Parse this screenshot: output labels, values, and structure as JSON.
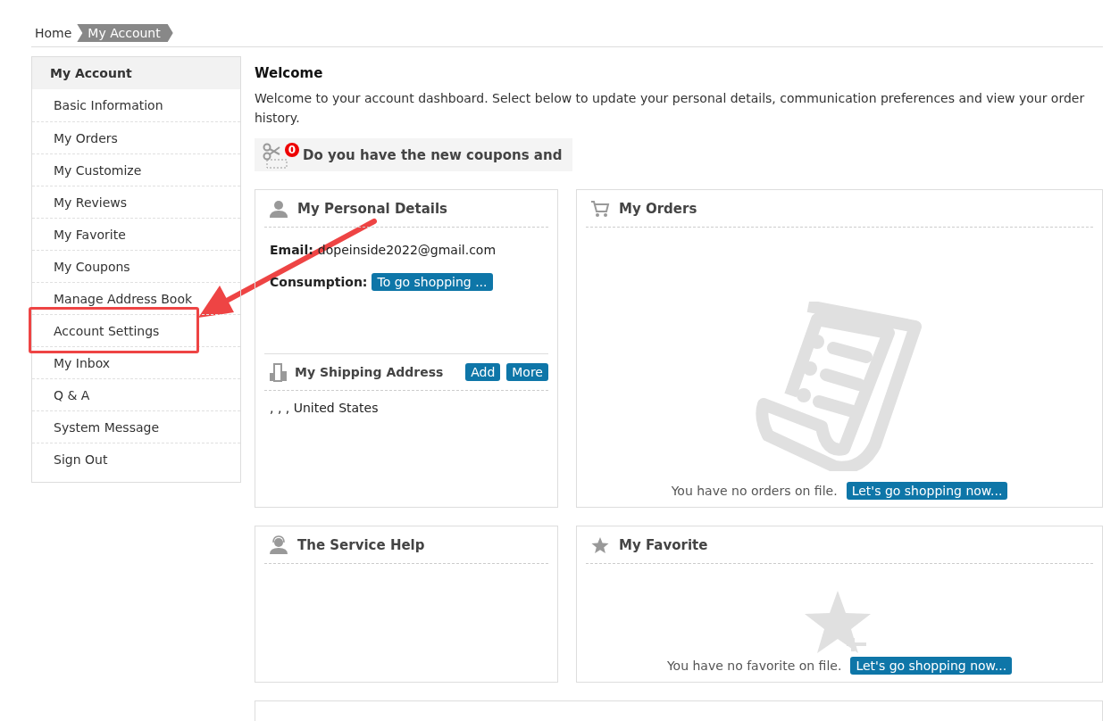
{
  "breadcrumb": [
    {
      "label": "Home",
      "selected": false
    },
    {
      "label": "My Account",
      "selected": true
    }
  ],
  "sidebar": {
    "title": "My Account",
    "items": [
      {
        "label": "Basic Information",
        "highlighted": false
      },
      {
        "label": "My Orders",
        "highlighted": false
      },
      {
        "label": "My Customize",
        "highlighted": false
      },
      {
        "label": "My Reviews",
        "highlighted": false
      },
      {
        "label": "My Favorite",
        "highlighted": false
      },
      {
        "label": "My Coupons",
        "highlighted": false
      },
      {
        "label": "Manage Address Book",
        "highlighted": false
      },
      {
        "label": "Account Settings",
        "highlighted": true
      },
      {
        "label": "My Inbox",
        "highlighted": false
      },
      {
        "label": "Q & A",
        "highlighted": false
      },
      {
        "label": "System Message",
        "highlighted": false
      },
      {
        "label": "Sign Out",
        "highlighted": false
      }
    ]
  },
  "welcome": {
    "title": "Welcome",
    "text": "Welcome to your account dashboard. Select below to update your personal details, communication preferences and view your order history."
  },
  "coupon": {
    "count": "0",
    "text": "Do you have the new coupons and"
  },
  "personal_details": {
    "title": "My Personal Details",
    "email_label": "Email:",
    "email": "dopeinside2022@gmail.com",
    "consumption_label": "Consumption:",
    "consumption_button": "To go shopping ..."
  },
  "shipping_address": {
    "title": "My Shipping Address",
    "buttons": [
      "Add",
      "More"
    ],
    "address": ", , , United States"
  },
  "orders": {
    "title": "My Orders",
    "empty_text": "You have no orders on file.",
    "button": "Let's go shopping now..."
  },
  "service_help": {
    "title": "The Service Help"
  },
  "favorite": {
    "title": "My Favorite",
    "empty_text": "You have no favorite on file.",
    "button": "Let's go shopping now..."
  }
}
